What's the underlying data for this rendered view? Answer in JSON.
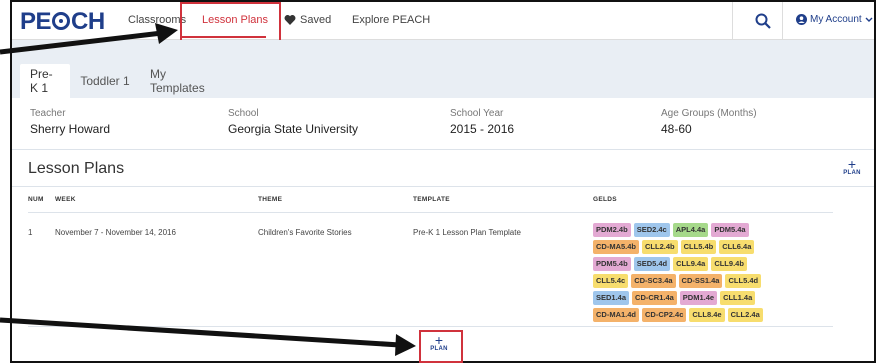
{
  "app": {
    "logo": "PEACH"
  },
  "nav": {
    "classrooms": "Classrooms",
    "lesson_plans": "Lesson Plans",
    "saved": "Saved",
    "explore": "Explore PEACH",
    "account": "My Account"
  },
  "tabs": [
    "Pre-K 1",
    "Toddler 1",
    "My Templates"
  ],
  "info": {
    "teacher_label": "Teacher",
    "teacher": "Sherry Howard",
    "school_label": "School",
    "school": "Georgia State University",
    "year_label": "School Year",
    "year": "2015 - 2016",
    "age_label": "Age Groups (Months)",
    "age": "48-60"
  },
  "lesson_plans": {
    "title": "Lesson Plans",
    "add_label": "PLAN",
    "add_symbol": "+",
    "columns": {
      "num": "NUM",
      "week": "WEEK",
      "theme": "THEME",
      "template": "TEMPLATE",
      "gelds": "GELDS"
    },
    "rows": [
      {
        "num": "1",
        "week": "November 7 - November 14, 2016",
        "theme": "Children's Favorite Stories",
        "template": "Pre-K 1 Lesson Plan Template",
        "gelds": [
          [
            [
              "PDM2.4b",
              "pink"
            ],
            [
              "SED2.4c",
              "blue"
            ],
            [
              "APL4.4a",
              "green"
            ],
            [
              "PDM5.4a",
              "pink"
            ]
          ],
          [
            [
              "CD-MA5.4b",
              "orange"
            ],
            [
              "CLL2.4b",
              "yellow"
            ],
            [
              "CLL5.4b",
              "yellow"
            ],
            [
              "CLL6.4a",
              "yellow"
            ]
          ],
          [
            [
              "PDM5.4b",
              "pink"
            ],
            [
              "SED5.4d",
              "blue"
            ],
            [
              "CLL9.4a",
              "yellow"
            ],
            [
              "CLL9.4b",
              "yellow"
            ]
          ],
          [
            [
              "CLL5.4c",
              "yellow"
            ],
            [
              "CD-SC3.4a",
              "orange"
            ],
            [
              "CD-SS1.4a",
              "orange"
            ],
            [
              "CLL5.4d",
              "yellow"
            ]
          ],
          [
            [
              "SED1.4a",
              "blue"
            ],
            [
              "CD-CR1.4a",
              "orange"
            ],
            [
              "PDM1.4e",
              "pink"
            ],
            [
              "CLL1.4a",
              "yellow"
            ]
          ],
          [
            [
              "CD-MA1.4d",
              "orange"
            ],
            [
              "CD-CP2.4c",
              "orange"
            ],
            [
              "CLL8.4e",
              "yellow"
            ],
            [
              "CLL2.4a",
              "yellow"
            ]
          ]
        ]
      }
    ]
  },
  "colors": {
    "brand": "#1f3e8a",
    "accent": "#d0323c",
    "pink": "#e3a9d3",
    "blue": "#9fc6ec",
    "green": "#a6d98a",
    "orange": "#f4b26a",
    "yellow": "#f7dd6e"
  }
}
